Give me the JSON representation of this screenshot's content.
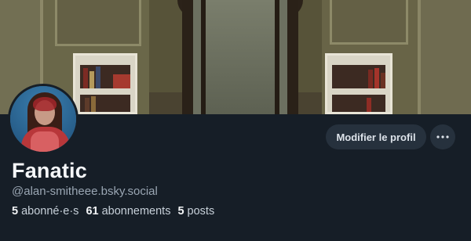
{
  "profile": {
    "display_name": "Fanatic",
    "handle": "@alan-smitheee.bsky.social",
    "edit_button_label": "Modifier le profil",
    "more_button_icon": "ellipsis-icon",
    "stats": [
      {
        "count": "5",
        "label": "abonné·e·s"
      },
      {
        "count": "61",
        "label": "abonnements"
      },
      {
        "count": "5",
        "label": "posts"
      }
    ]
  },
  "colors": {
    "background": "#161e27",
    "button_bg": "#26313d",
    "handle_text": "#9aa6b3"
  }
}
